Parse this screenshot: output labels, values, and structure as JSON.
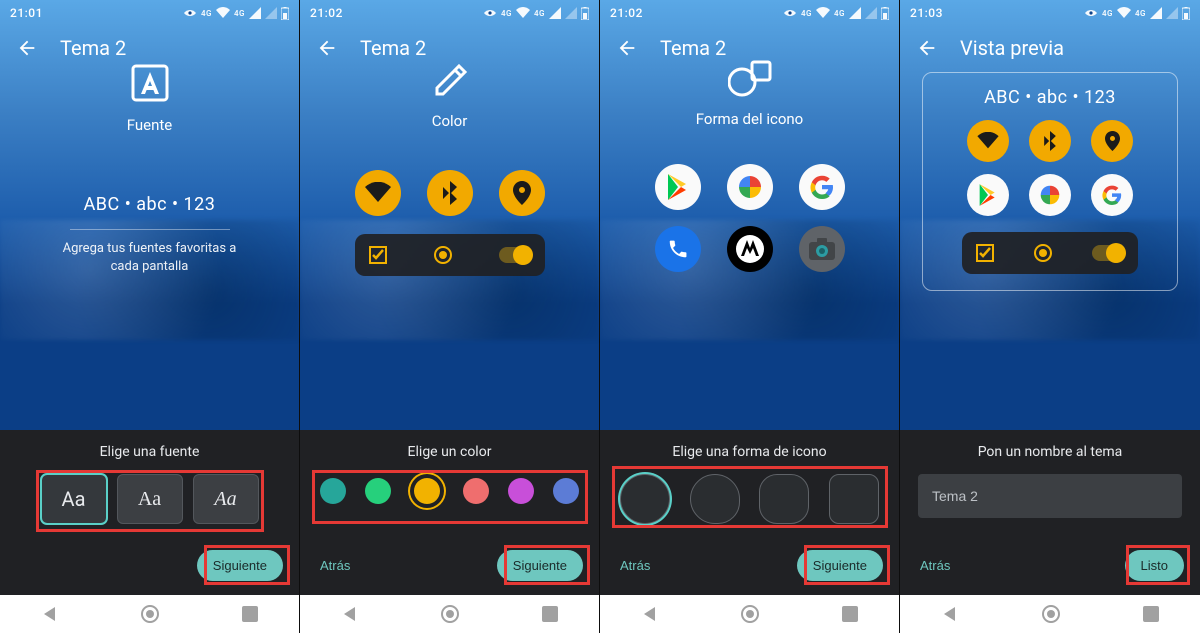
{
  "status": {
    "net_label": "4G"
  },
  "screens": [
    {
      "time": "21:01",
      "title": "Tema 2",
      "hero": {
        "label": "Fuente",
        "sample": "ABC • abc • 123",
        "description": "Agrega tus fuentes favoritas a cada pantalla"
      },
      "panel": {
        "heading": "Elige una fuente",
        "fonts": [
          "Aa",
          "Aa",
          "Aa"
        ]
      },
      "back_label": null,
      "next_label": "Siguiente"
    },
    {
      "time": "21:02",
      "title": "Tema 2",
      "hero": {
        "label": "Color"
      },
      "panel": {
        "heading": "Elige un color",
        "colors": [
          "#26a69a",
          "#26d07c",
          "#f2b200",
          "#ef6e6e",
          "#c84fd9",
          "#5c7cd6"
        ]
      },
      "back_label": "Atrás",
      "next_label": "Siguiente"
    },
    {
      "time": "21:02",
      "title": "Tema 2",
      "hero": {
        "label": "Forma del icono"
      },
      "panel": {
        "heading": "Elige una forma de icono"
      },
      "back_label": "Atrás",
      "next_label": "Siguiente"
    },
    {
      "time": "21:03",
      "title": "Vista previa",
      "hero": {
        "sample": "ABC • abc • 123"
      },
      "panel": {
        "heading": "Pon un nombre al tema",
        "name_value": "Tema 2"
      },
      "back_label": "Atrás",
      "next_label": "Listo"
    }
  ]
}
